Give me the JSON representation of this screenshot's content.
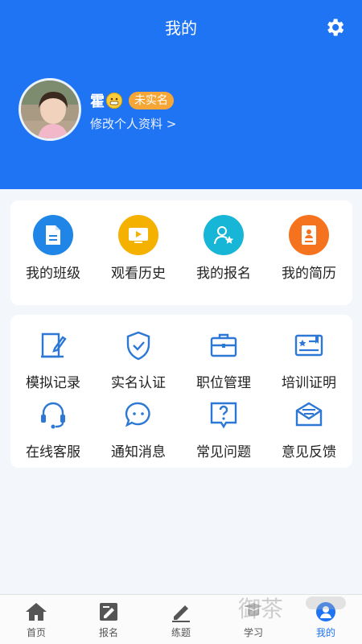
{
  "header": {
    "title": "我的"
  },
  "profile": {
    "name": "霍",
    "badge": "未实名",
    "edit_link": "修改个人资料 >"
  },
  "quick_actions": [
    {
      "label": "我的班级",
      "icon": "document-icon",
      "color": "#1f86e8"
    },
    {
      "label": "观看历史",
      "icon": "play-icon",
      "color": "#f5b100"
    },
    {
      "label": "我的报名",
      "icon": "user-star-icon",
      "color": "#18b6d6"
    },
    {
      "label": "我的简历",
      "icon": "resume-icon",
      "color": "#f5731f"
    }
  ],
  "services": [
    {
      "label": "模拟记录",
      "icon": "edit-book-icon"
    },
    {
      "label": "实名认证",
      "icon": "shield-check-icon"
    },
    {
      "label": "职位管理",
      "icon": "briefcase-icon"
    },
    {
      "label": "培训证明",
      "icon": "certificate-icon"
    },
    {
      "label": "在线客服",
      "icon": "headset-icon"
    },
    {
      "label": "通知消息",
      "icon": "chat-bubble-icon"
    },
    {
      "label": "常见问题",
      "icon": "question-icon"
    },
    {
      "label": "意见反馈",
      "icon": "mail-icon"
    }
  ],
  "tabbar": [
    {
      "label": "首页",
      "icon": "home-icon",
      "active": false
    },
    {
      "label": "报名",
      "icon": "signup-icon",
      "active": false
    },
    {
      "label": "练题",
      "icon": "pencil-icon",
      "active": false
    },
    {
      "label": "学习",
      "icon": "study-icon",
      "active": false
    },
    {
      "label": "我的",
      "icon": "profile-icon",
      "active": true
    }
  ],
  "watermark": {
    "text": "御茶"
  },
  "colors": {
    "primary": "#1f74f4",
    "badge": "#f6a637",
    "line_icon": "#2c78d4"
  }
}
